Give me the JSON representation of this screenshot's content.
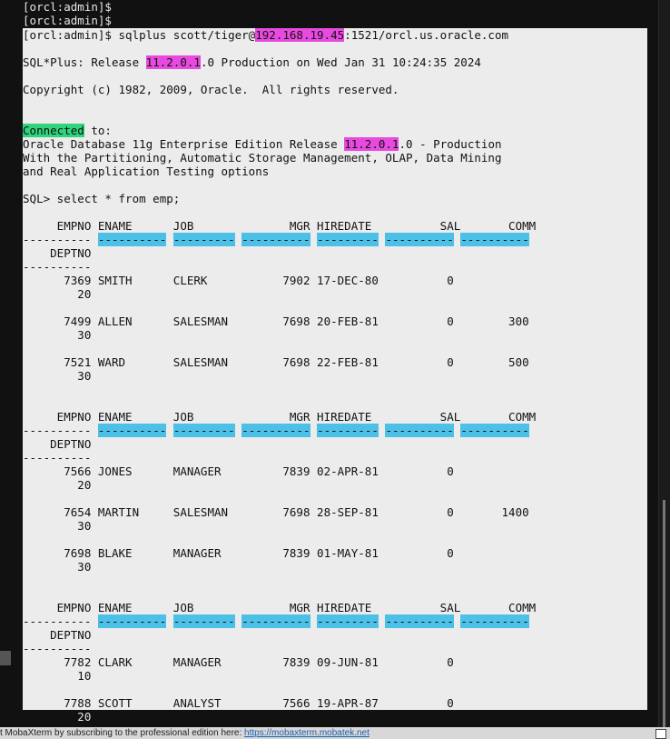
{
  "terminal": {
    "prompt_lines": [
      "[orcl:admin]$",
      "[orcl:admin]$"
    ],
    "command": {
      "prefix": "[orcl:admin]$ sqlplus scott/tiger@",
      "ip": "192.168.19.45",
      "suffix": ":1521/orcl.us.oracle.com"
    },
    "banner": {
      "prefix": "SQL*Plus: Release ",
      "version": "11.2.0.1",
      "suffix": ".0 Production on Wed Jan 31 10:24:35 2024"
    },
    "copyright": "Copyright (c) 1982, 2009, Oracle.  All rights reserved.",
    "connected": {
      "word": "Connected",
      "rest": " to:"
    },
    "db_line": {
      "prefix": "Oracle Database 11g Enterprise Edition Release ",
      "version": "11.2.0.1",
      "suffix": ".0 - Production"
    },
    "options_lines": [
      "With the Partitioning, Automatic Storage Management, OLAP, Data Mining",
      "and Real Application Testing options"
    ],
    "query": "SQL> select * from emp;",
    "header_line": "     EMPNO ENAME      JOB              MGR HIREDATE          SAL       COMM",
    "deptno_header": "    DEPTNO",
    "rows": [
      {
        "line": "      7369 SMITH      CLERK           7902 17-DEC-80          0",
        "dept": "        20"
      },
      {
        "line": "      7499 ALLEN      SALESMAN        7698 20-FEB-81          0        300",
        "dept": "        30"
      },
      {
        "line": "      7521 WARD       SALESMAN        7698 22-FEB-81          0        500",
        "dept": "        30"
      },
      {
        "line": "      7566 JONES      MANAGER         7839 02-APR-81          0",
        "dept": "        20"
      },
      {
        "line": "      7654 MARTIN     SALESMAN        7698 28-SEP-81          0       1400",
        "dept": "        30"
      },
      {
        "line": "      7698 BLAKE      MANAGER         7839 01-MAY-81          0",
        "dept": "        30"
      },
      {
        "line": "      7782 CLARK      MANAGER         7839 09-JUN-81          0",
        "dept": "        10"
      },
      {
        "line": "      7788 SCOTT      ANALYST         7566 19-APR-87          0",
        "dept": "        20"
      }
    ]
  },
  "statusbar": {
    "text": "t MobaXterm by subscribing to the professional edition here:  ",
    "link": "https://mobaxterm.mobatek.net"
  },
  "colors": {
    "highlight_magenta": "#e84ae0",
    "highlight_green": "#2fd47d",
    "highlight_blue": "#4cc0e6"
  }
}
